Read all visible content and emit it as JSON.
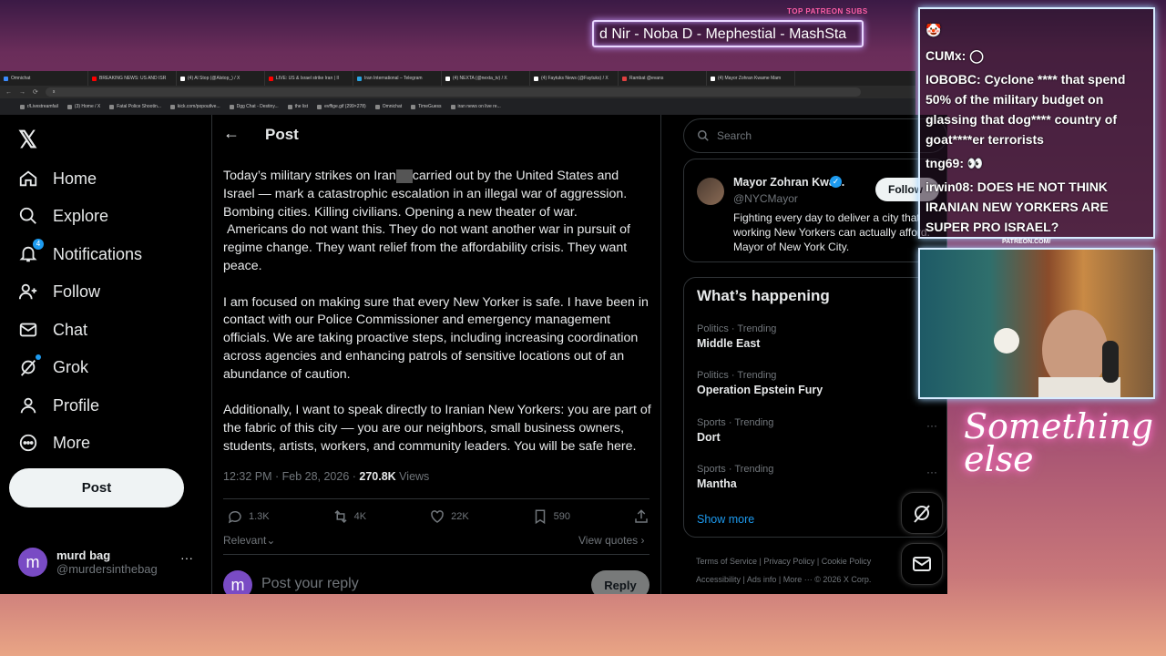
{
  "stream": {
    "subs_title": "TOP PATREON SUBS",
    "subs_ticker": "d Nir - Noba D - Mephestial - MashSta",
    "patreon_label": "PATREON.COM/",
    "logo_text": "Something else"
  },
  "browser": {
    "tabs": [
      {
        "label": "Omnichat",
        "color": "#3c8cff"
      },
      {
        "label": "BREAKING NEWS: US AND ISR",
        "color": "#ff0000"
      },
      {
        "label": "(4) Al Stop (@Alstop_) / X",
        "color": "#ffffff"
      },
      {
        "label": "LIVE: US & Israel strike Iran | Il",
        "color": "#ff0000"
      },
      {
        "label": "Iran International – Telegram",
        "color": "#2aa3e0"
      },
      {
        "label": "(4) NEXTA (@nexta_tv) / X",
        "color": "#ffffff"
      },
      {
        "label": "(4) Faytuks News (@Faytuks) / X",
        "color": "#ffffff"
      },
      {
        "label": "Rambat @evans",
        "color": "#e04040"
      },
      {
        "label": "(4) Mayor Zohran Kwame Mam",
        "color": "#ffffff"
      }
    ],
    "url": "x",
    "bookmarks": [
      "r/Livestreamfail",
      "(3) Home / X",
      "Fatal Police Shootin...",
      "kick.com/popoutlve...",
      "Dgg Chat - Destiny...",
      "the list",
      "evffige.gif (299×278)",
      "Omnichat",
      "TimeGuess",
      "iran news on live re..."
    ]
  },
  "x": {
    "logo": "𝕏",
    "nav": [
      {
        "key": "home",
        "label": "Home"
      },
      {
        "key": "explore",
        "label": "Explore"
      },
      {
        "key": "notifications",
        "label": "Notifications",
        "badge": "4"
      },
      {
        "key": "follow",
        "label": "Follow"
      },
      {
        "key": "chat",
        "label": "Chat"
      },
      {
        "key": "grok",
        "label": "Grok"
      },
      {
        "key": "profile",
        "label": "Profile"
      },
      {
        "key": "more",
        "label": "More"
      }
    ],
    "post_button": "Post",
    "account": {
      "avatar": "m",
      "name": "murd bag",
      "handle": "@murdersinthebag",
      "more": "···"
    }
  },
  "post": {
    "back": "←",
    "title": "Post",
    "body_1a": "Today’s military strikes on Iran",
    "body_1b": "carried out by the United States and Israel — mark a catastrophic escalation in an illegal war of aggression. Bombing cities. Killing civilians. Opening a new theater of war.\n Americans do not want this. They do not want another war in pursuit of regime change. They want relief from the affordability crisis. They want peace.",
    "body_2": "I am focused on making sure that every New Yorker is safe. I have been in contact with our Police Commissioner and emergency management officials. We are taking proactive steps, including increasing coordination across agencies and enhancing patrols of sensitive locations out of an abundance of caution.",
    "body_3": "Additionally, I want to speak directly to Iranian New Yorkers: you are part of the fabric of this city — you are our neighbors, small business owners, students, artists, workers, and community leaders. You will be safe here.",
    "time": "12:32 PM · Feb 28, 2026 · ",
    "views_count": "270.8K",
    "views_label": " Views",
    "replies": "1.3K",
    "reposts": "4K",
    "likes": "22K",
    "bookmarks": "590",
    "sort": "Relevant⌄",
    "view_quotes": "View quotes ›",
    "reply_avatar": "m",
    "reply_placeholder": "Post your reply",
    "reply_button": "Reply"
  },
  "sidebar": {
    "search_placeholder": "Search",
    "profile": {
      "name": "Mayor Zohran Kwa...",
      "handle": "@NYCMayor",
      "follow": "Follow",
      "bio": "Fighting every day to deliver a city that working New Yorkers can actually afford. Mayor of New York City."
    },
    "happening_title": "What’s happening",
    "trends": [
      {
        "category": "Politics · Trending",
        "title": "Middle East"
      },
      {
        "category": "Politics · Trending",
        "title": "Operation Epstein Fury"
      },
      {
        "category": "Sports · Trending",
        "title": "Dort"
      },
      {
        "category": "Sports · Trending",
        "title": "Mantha"
      }
    ],
    "show_more": "Show more",
    "footer_1": "Terms of Service  |  Privacy Policy  |  Cookie Policy",
    "footer_2": "Accessibility  |  Ads info  |  More ···  © 2026 X Corp."
  },
  "chat": [
    {
      "user": "",
      "text": ""
    },
    {
      "user": "CUMx:",
      "text": ""
    },
    {
      "user": "IOBOBC:",
      "text": "Cyclone **** that spend 50% of the military budget on glassing that dog**** country of goat****er terrorists"
    },
    {
      "user": "tng69:",
      "text": ""
    },
    {
      "user": "irwin08:",
      "text": "DOES HE NOT THINK IRANIAN NEW YORKERS ARE SUPER PRO ISRAEL?"
    }
  ]
}
